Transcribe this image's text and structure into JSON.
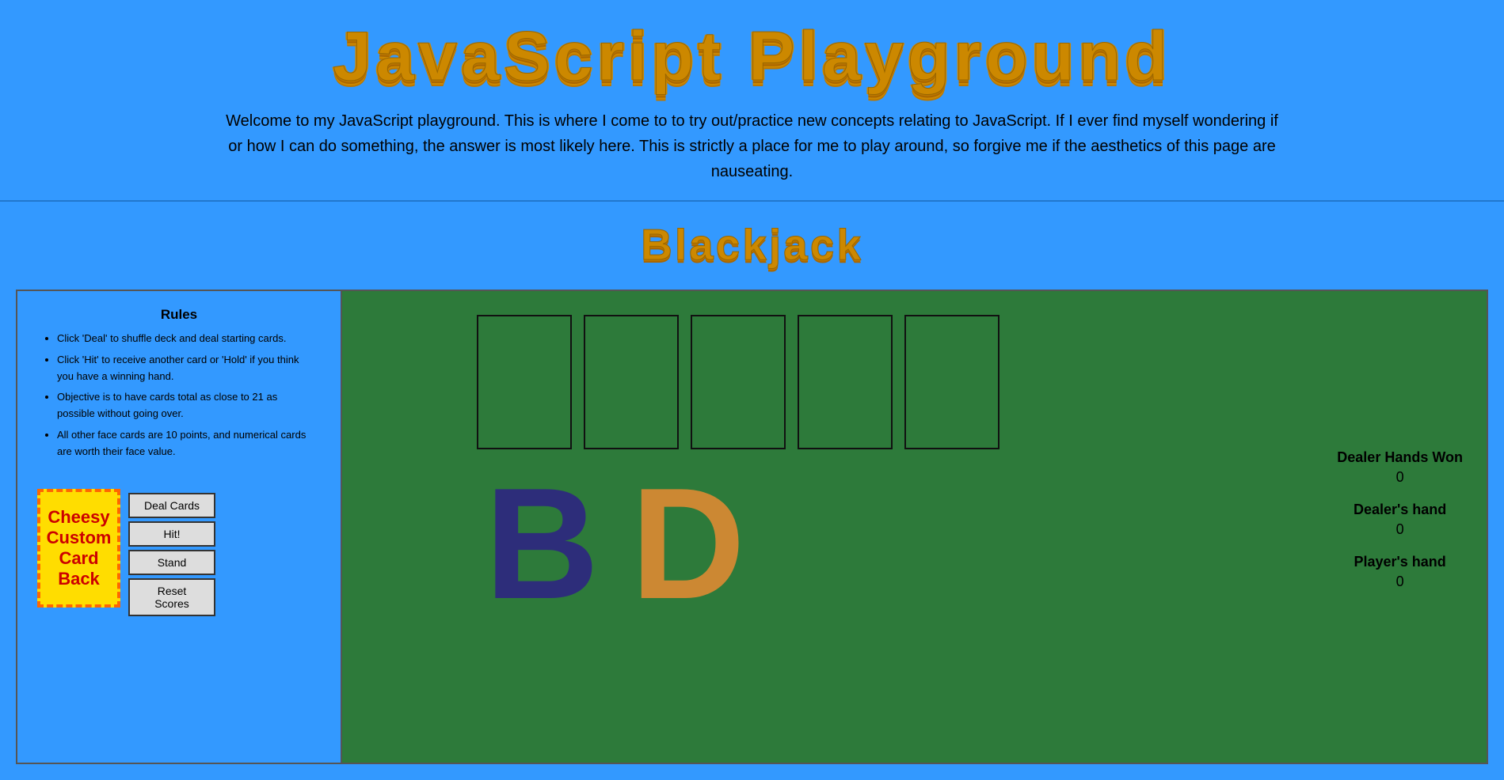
{
  "header": {
    "title": "JavaScript Playground",
    "subtitle_line1": "Welcome to my JavaScript playground. This is where I come to to try out/practice new concepts relating to JavaScript. If I ever find myself wondering if",
    "subtitle_line2": "or how I can do something, the answer is most likely here. This is strictly a place for me to play around, so forgive me if the aesthetics of this page are",
    "subtitle_line3": "nauseating."
  },
  "blackjack": {
    "title": "Blackjack"
  },
  "rules": {
    "title": "Rules",
    "items": [
      "Click 'Deal' to shuffle deck and deal starting cards.",
      "Click 'Hit' to receive another card or 'Hold' if you think you have a winning hand.",
      "Objective is to have cards total as close to 21 as possible without going over.",
      "All other face cards are 10 points, and numerical cards are worth their face value."
    ]
  },
  "card_back": {
    "label": "Cheesy Custom Card Back"
  },
  "buttons": {
    "deal": "Deal Cards",
    "hit": "Hit!",
    "stand": "Stand",
    "reset": "Reset Scores"
  },
  "scores": {
    "dealer_hands_won_label": "Dealer Hands Won",
    "dealer_hands_won_value": "0",
    "dealer_hand_label": "Dealer's hand",
    "dealer_hand_value": "0",
    "player_hand_label": "Player's hand",
    "player_hand_value": "0"
  },
  "card_slots": [
    {
      "id": 1
    },
    {
      "id": 2
    },
    {
      "id": 3
    },
    {
      "id": 4
    },
    {
      "id": 5
    }
  ],
  "big_letters": {
    "b": "B",
    "d": "D"
  }
}
